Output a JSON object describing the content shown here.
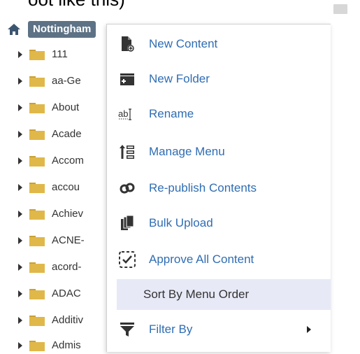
{
  "caption": "oot like this)",
  "tree": {
    "root_label": "Nottingham",
    "items": [
      {
        "label": "111"
      },
      {
        "label": "aa-Ge"
      },
      {
        "label": "About"
      },
      {
        "label": "Acade"
      },
      {
        "label": "Accom"
      },
      {
        "label": "accou"
      },
      {
        "label": "Achiev"
      },
      {
        "label": "ACNE-"
      },
      {
        "label": "acord-"
      },
      {
        "label": "ADAC"
      },
      {
        "label": "Additiv"
      },
      {
        "label": "Admis"
      }
    ]
  },
  "context_menu": {
    "items": [
      {
        "label": "New Content",
        "icon": "new-content-icon"
      },
      {
        "label": "New Folder",
        "icon": "new-folder-icon"
      },
      {
        "label": "Rename",
        "icon": "rename-icon"
      },
      {
        "label": "Manage Menu",
        "icon": "manage-menu-icon"
      },
      {
        "label": "Re-publish Contents",
        "icon": "republish-icon"
      },
      {
        "label": "Bulk Upload",
        "icon": "bulk-upload-icon"
      },
      {
        "label": "Approve All Content",
        "icon": "approve-icon"
      },
      {
        "label": "Sort By Menu Order",
        "icon": ""
      },
      {
        "label": "Filter By",
        "icon": "filter-icon"
      }
    ],
    "active_item": "Sort By Menu Order"
  },
  "colors": {
    "root_badge_bg": "#5e7286",
    "menu_link": "#2f6db3",
    "active_row_bg": "#e7e9f6",
    "folder": "#e0b84a"
  }
}
